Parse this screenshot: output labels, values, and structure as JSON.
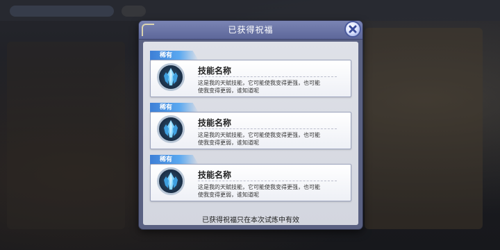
{
  "dialog": {
    "title": "已获得祝福",
    "footer": "已获得祝福只在本次试炼中有效"
  },
  "cards": [
    {
      "rarity": "稀有",
      "name": "技能名称",
      "desc_line1": "这是我的天赋技能，它可能使我变得更强，也可能",
      "desc_line2": "使我变得更弱，谁知道呢",
      "icon": "blue-crystal-icon"
    },
    {
      "rarity": "稀有",
      "name": "技能名称",
      "desc_line1": "这是我的天赋技能，它可能使我变得更强，也可能",
      "desc_line2": "使我变得更弱，谁知道呢",
      "icon": "blue-crystal-icon"
    },
    {
      "rarity": "稀有",
      "name": "技能名称",
      "desc_line1": "这是我的天赋技能，它可能使我变得更强，也可能",
      "desc_line2": "使我变得更弱，谁知道呢",
      "icon": "blue-crystal-icon"
    }
  ],
  "colors": {
    "title_bar": "#6a74a8",
    "rarity_tag": "#4a93e6",
    "content_bg": "#dadce4"
  }
}
